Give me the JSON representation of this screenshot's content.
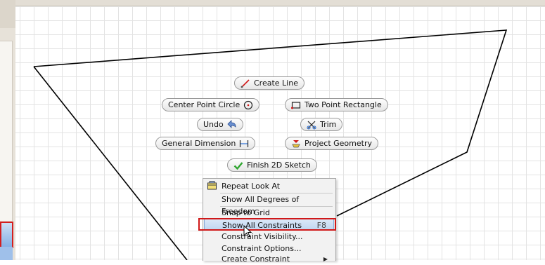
{
  "app": {
    "accent_color": "#d01818",
    "highlight_color": "#c0d6f1"
  },
  "marking_menu": {
    "create_line": {
      "label": "Create Line",
      "icon": "line-icon"
    },
    "center_point_circle": {
      "label": "Center Point Circle",
      "icon": "circle-icon"
    },
    "two_point_rectangle": {
      "label": "Two Point Rectangle",
      "icon": "rectangle-icon"
    },
    "undo": {
      "label": "Undo",
      "icon": "undo-icon"
    },
    "trim": {
      "label": "Trim",
      "icon": "trim-icon"
    },
    "general_dimension": {
      "label": "General Dimension",
      "icon": "dimension-icon"
    },
    "project_geometry": {
      "label": "Project Geometry",
      "icon": "project-geometry-icon"
    },
    "finish_2d_sketch": {
      "label": "Finish 2D Sketch",
      "icon": "checkmark-icon"
    }
  },
  "context_menu": {
    "items": [
      {
        "label": "Repeat Look At",
        "icon": "look-at-icon"
      },
      {
        "label": "Show All Degrees of Freedom"
      },
      {
        "label": "Snap to Grid"
      },
      {
        "label": "Show All Constraints",
        "shortcut": "F8",
        "highlighted": true
      },
      {
        "label": "Constraint Visibility..."
      },
      {
        "label": "Constraint Options..."
      },
      {
        "label": "Create Constraint",
        "submenu": true
      }
    ]
  }
}
